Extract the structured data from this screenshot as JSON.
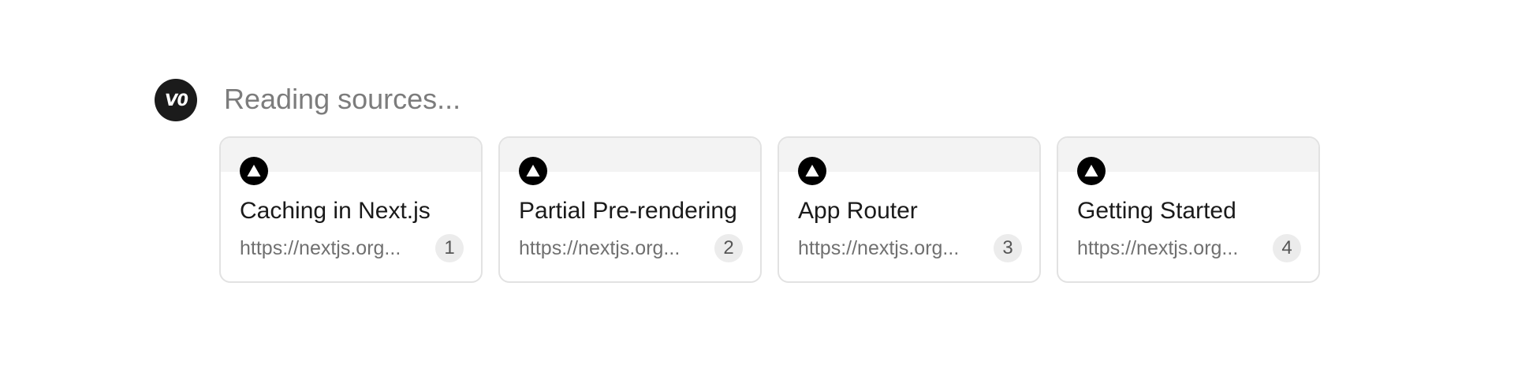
{
  "assistant": {
    "avatar_label": "V0",
    "status": "Reading sources..."
  },
  "sources": [
    {
      "title": "Caching in Next.js",
      "url": "https://nextjs.org...",
      "index": "1",
      "icon": "vercel-triangle-icon"
    },
    {
      "title": "Partial Pre-rendering",
      "url": "https://nextjs.org...",
      "index": "2",
      "icon": "vercel-triangle-icon"
    },
    {
      "title": "App Router",
      "url": "https://nextjs.org...",
      "index": "3",
      "icon": "vercel-triangle-icon"
    },
    {
      "title": "Getting Started",
      "url": "https://nextjs.org...",
      "index": "4",
      "icon": "vercel-triangle-icon"
    }
  ],
  "colors": {
    "avatar_bg": "#1b1b1b",
    "status_text": "#7c7c7c",
    "card_border": "#e2e2e2",
    "card_band": "#f3f3f3",
    "index_badge_bg": "#ececec"
  }
}
